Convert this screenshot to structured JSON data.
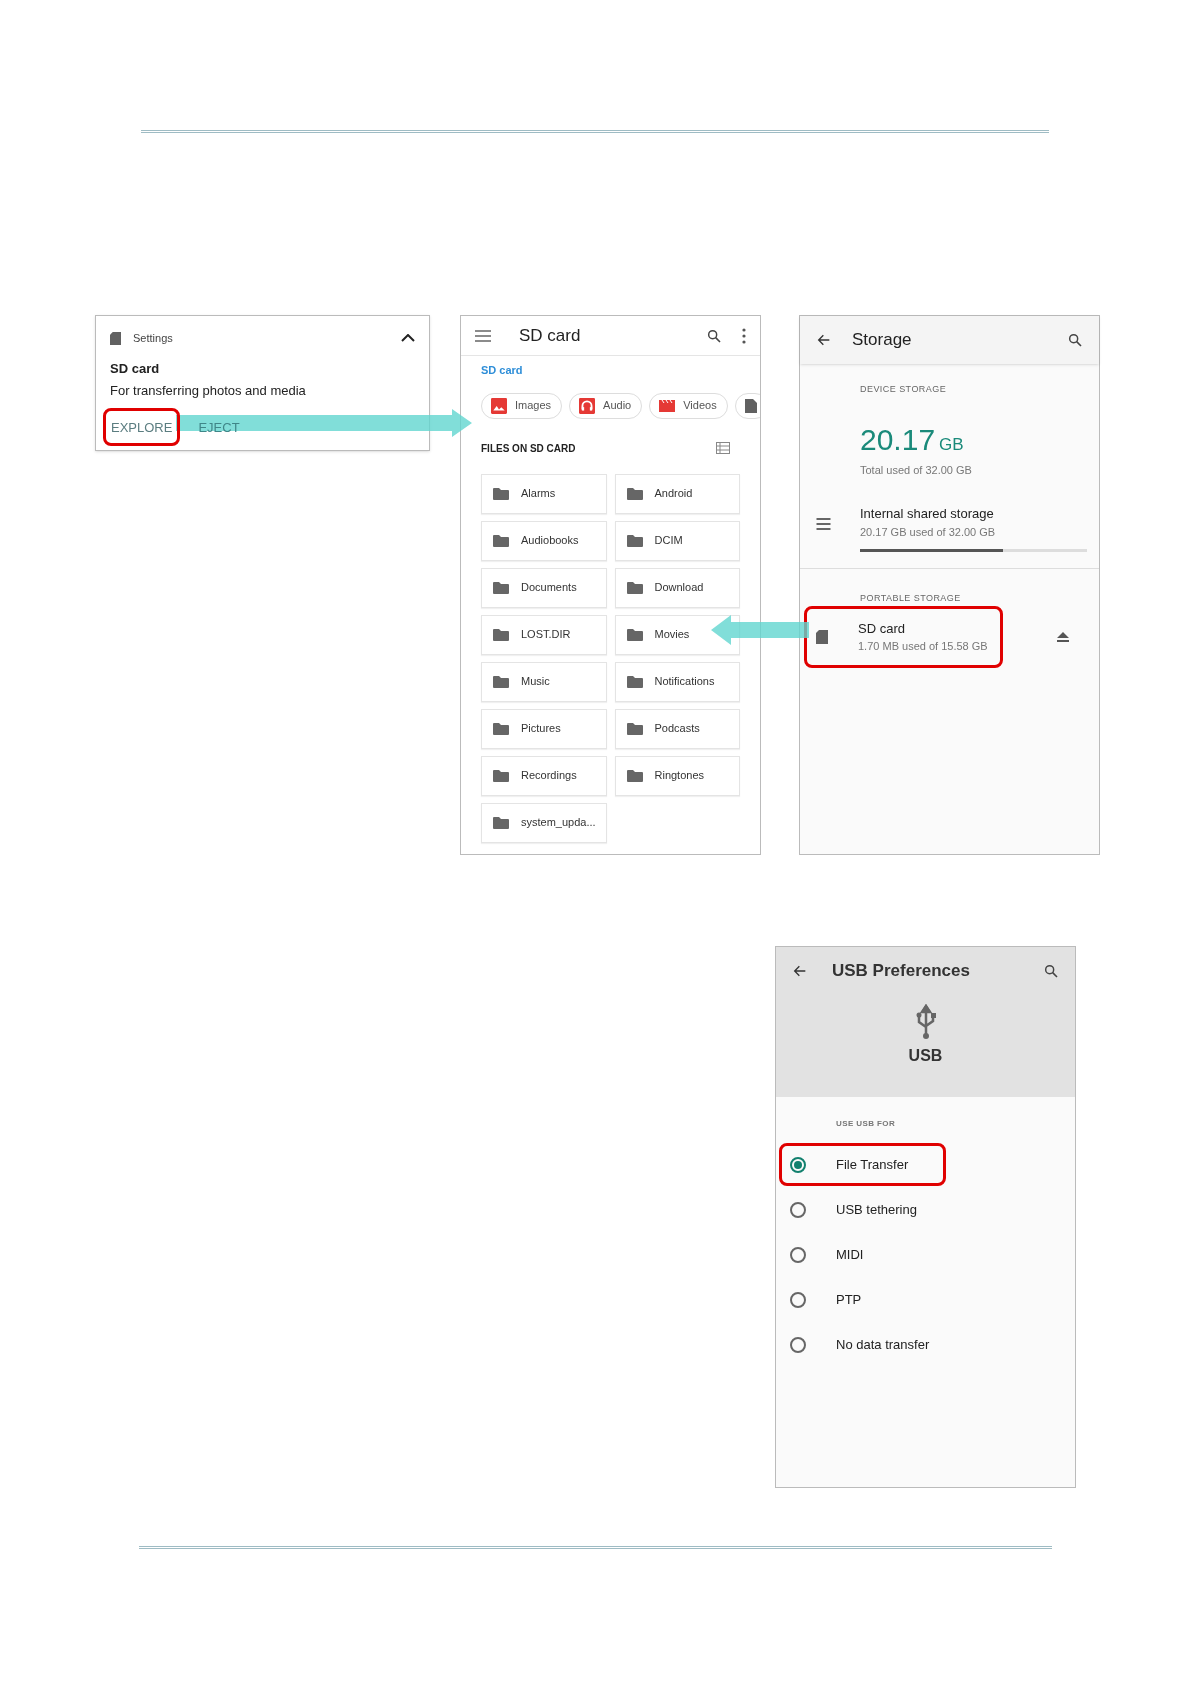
{
  "notification": {
    "app": "Settings",
    "title": "SD card",
    "text": "For transferring photos and media",
    "actions": [
      {
        "label": "EXPLORE",
        "highlighted": true
      },
      {
        "label": "EJECT",
        "highlighted": false
      }
    ]
  },
  "files_app": {
    "title": "SD card",
    "breadcrumb": "SD card",
    "chips": [
      {
        "kind": "image",
        "label": "Images"
      },
      {
        "kind": "audio",
        "label": "Audio"
      },
      {
        "kind": "video",
        "label": "Videos"
      },
      {
        "kind": "document"
      }
    ],
    "section": "FILES ON SD CARD",
    "folders": [
      "Alarms",
      "Android",
      "Audiobooks",
      "DCIM",
      "Documents",
      "Download",
      "LOST.DIR",
      "Movies",
      "Music",
      "Notifications",
      "Pictures",
      "Podcasts",
      "Recordings",
      "Ringtones",
      "system_upda..."
    ]
  },
  "storage": {
    "title": "Storage",
    "device_header": "DEVICE STORAGE",
    "used_value": "20.17",
    "used_unit": "GB",
    "used_caption": "Total used of 32.00 GB",
    "internal": {
      "title": "Internal shared storage",
      "summary": "20.17 GB used of 32.00 GB",
      "level": 0.63
    },
    "portable_header": "PORTABLE STORAGE",
    "sd": {
      "title": "SD card",
      "summary": "1.70 MB used of 15.58 GB",
      "highlighted": true
    }
  },
  "usb": {
    "title": "USB Preferences",
    "label": "USB",
    "section": "USE USB FOR",
    "options": [
      {
        "label": "File Transfer",
        "selected": true,
        "highlighted": true
      },
      {
        "label": "USB tethering",
        "selected": false,
        "highlighted": false
      },
      {
        "label": "MIDI",
        "selected": false,
        "highlighted": false
      },
      {
        "label": "PTP",
        "selected": false,
        "highlighted": false
      },
      {
        "label": "No data transfer",
        "selected": false,
        "highlighted": false
      }
    ]
  }
}
